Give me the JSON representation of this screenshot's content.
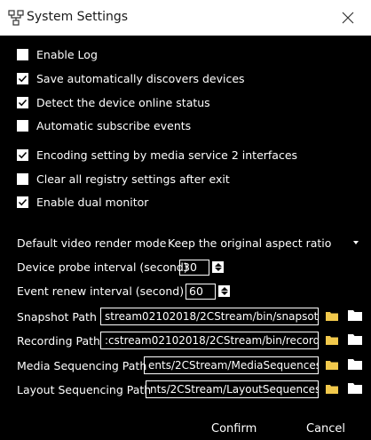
{
  "window": {
    "title": "System Settings",
    "app_icon": "network-nodes-icon",
    "close_icon": "close-icon"
  },
  "options": [
    {
      "label": "Enable Log",
      "checked": false
    },
    {
      "label": "Save automatically discovers devices",
      "checked": true
    },
    {
      "label": "Detect the device online status",
      "checked": true
    },
    {
      "label": "Automatic subscribe events",
      "checked": false
    },
    {
      "label": "Encoding setting by media service 2 interfaces",
      "checked": true
    },
    {
      "label": "Clear all registry settings after exit",
      "checked": false
    },
    {
      "label": "Enable dual monitor",
      "checked": true
    }
  ],
  "render_mode": {
    "label": "Default video render mode",
    "value": "Keep the original aspect ratio"
  },
  "probe_interval": {
    "label": "Device probe interval (second)",
    "value": "30"
  },
  "renew_interval": {
    "label": "Event renew interval  (second)",
    "value": "60"
  },
  "paths": [
    {
      "label": "Snapshot Path",
      "value": "stream02102018/2CStream/bin/snapsot"
    },
    {
      "label": "Recording Path",
      "value": ":cstream02102018/2CStream/bin/record"
    },
    {
      "label": "Media Sequencing Path",
      "value": "ents/2CStream/MediaSequences"
    },
    {
      "label": "Layout Sequencing Path",
      "value": "nts/2CStream/LayoutSequences"
    }
  ],
  "buttons": {
    "confirm": "Confirm",
    "cancel": "Cancel"
  },
  "colors": {
    "folder_yellow": "#f2c94c",
    "background": "#000000",
    "titlebar": "#ffffff"
  }
}
